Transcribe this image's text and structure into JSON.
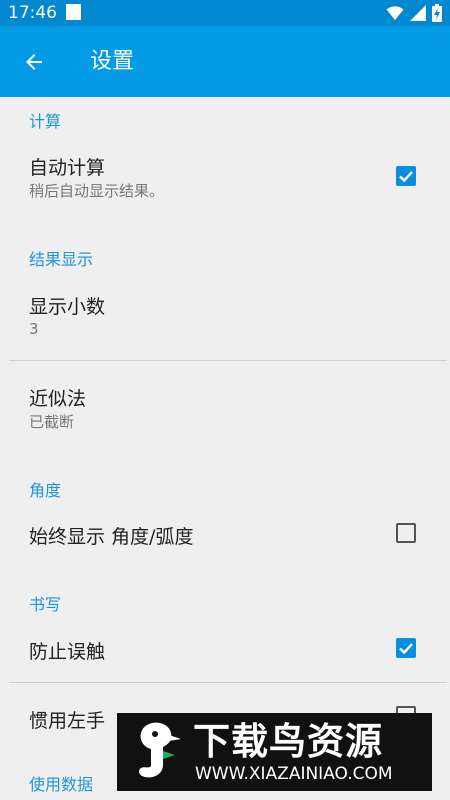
{
  "status_bar": {
    "time": "17:46",
    "icons": [
      "wifi-icon",
      "signal-icon",
      "battery-charging-icon"
    ]
  },
  "app_bar": {
    "title": "设置",
    "back_icon": "arrow-left-icon"
  },
  "sections": {
    "calculation": {
      "header": "计算",
      "auto_calc": {
        "title": "自动计算",
        "summary": "稍后自动显示结果。",
        "checked": true
      }
    },
    "result_display": {
      "header": "结果显示",
      "decimals": {
        "title": "显示小数",
        "summary": "3"
      },
      "approximation": {
        "title": "近似法",
        "summary": "已截断"
      }
    },
    "angle": {
      "header": "角度",
      "always_show": {
        "title": "始终显示 角度/弧度",
        "checked": false
      }
    },
    "writing": {
      "header": "书写",
      "prevent_mistouch": {
        "title": "防止误触",
        "checked": true
      },
      "left_handed": {
        "title": "惯用左手",
        "checked": false
      }
    },
    "usage_data": {
      "header": "使用数据"
    }
  },
  "watermark": {
    "title": "下载鸟资源",
    "url": "WWW.XIAZAINIAO.COM"
  },
  "colors": {
    "status_bar": "#0288d1",
    "app_bar": "#039be5",
    "accent": "#1e96dc",
    "background": "#efefef"
  }
}
